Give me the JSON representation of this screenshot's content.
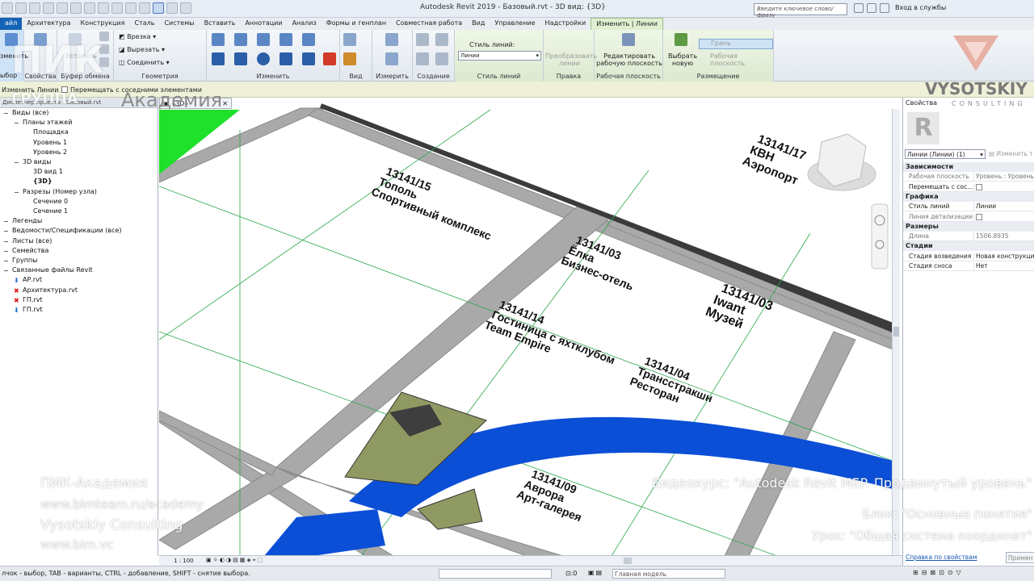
{
  "titlebar": {
    "title": "Autodesk Revit 2019 - Базовый.rvt - 3D вид: {3D}",
    "search_placeholder": "Введите ключевое слово/фразу",
    "login": "Вход в службы"
  },
  "tabs": [
    {
      "label": "айл",
      "kind": "file"
    },
    {
      "label": "Архитектура"
    },
    {
      "label": "Конструкция"
    },
    {
      "label": "Сталь"
    },
    {
      "label": "Системы"
    },
    {
      "label": "Вставить"
    },
    {
      "label": "Аннотации"
    },
    {
      "label": "Анализ"
    },
    {
      "label": "Формы и генплан"
    },
    {
      "label": "Совместная работа"
    },
    {
      "label": "Вид"
    },
    {
      "label": "Управление"
    },
    {
      "label": "Надстройки"
    },
    {
      "label": "Изменить | Линии",
      "kind": "active"
    }
  ],
  "ribbon": {
    "modify_label": "зменить",
    "insert_label": "Вставить",
    "select_label": "ыбор",
    "properties_label": "Свойства",
    "clipboard_label": "Буфер обмена",
    "geometry_label": "Геометрия",
    "cut_label": "Врезка",
    "cut2_label": "Вырезать",
    "join_label": "Соединить",
    "modify_group_label": "Изменить",
    "view_group_label": "Вид",
    "measure_label": "Измерить",
    "create_label": "Создание",
    "line_style_caption": "Стиль линий:",
    "line_style_value": "Линии",
    "line_style_group": "Стиль линий",
    "convert_lines": "Преобразовать линии",
    "edit_label": "Правка",
    "edit_workplane": "Редактировать рабочую плоскость",
    "workplane_group": "Рабочая плоскость",
    "pick_new": "Выбрать новую",
    "face": "Грань",
    "work_plane": "Рабочая плоскость",
    "placement_group": "Размещение"
  },
  "optbar": {
    "text1": "Изменить Линии",
    "text2": "Перемещать с соседними элементами"
  },
  "browser": {
    "header": "Диспетчер проекта - Базовый.rvt",
    "items": [
      {
        "label": "Виды (все)",
        "level": 0
      },
      {
        "label": "Планы этажей",
        "level": 1
      },
      {
        "label": "Площадка",
        "level": 2
      },
      {
        "label": "Уровень 1",
        "level": 2
      },
      {
        "label": "Уровень 2",
        "level": 2
      },
      {
        "label": "3D виды",
        "level": 1
      },
      {
        "label": "3D вид 1",
        "level": 2
      },
      {
        "label": "{3D}",
        "level": 2,
        "bold": true
      },
      {
        "label": "Разрезы (Номер узла)",
        "level": 1
      },
      {
        "label": "Сечение 0",
        "level": 2
      },
      {
        "label": "Сечение 1",
        "level": 2
      },
      {
        "label": "Легенды",
        "level": 0
      },
      {
        "label": "Ведомости/Спецификации (все)",
        "level": 0
      },
      {
        "label": "Листы (все)",
        "level": 0
      },
      {
        "label": "Семейства",
        "level": 0
      },
      {
        "label": "Группы",
        "level": 0
      },
      {
        "label": "Связанные файлы Revit",
        "level": 0
      },
      {
        "label": "АР.rvt",
        "level": 1,
        "icon": "arrow"
      },
      {
        "label": "Архитектура.rvt",
        "level": 1,
        "icon": "cross"
      },
      {
        "label": "ГП.rvt",
        "level": 1,
        "icon": "cross"
      },
      {
        "label": "ГП.rvt",
        "level": 1,
        "icon": "arrow"
      }
    ]
  },
  "view_tab": {
    "label": "{3D}"
  },
  "view_scale": "1 : 100",
  "properties": {
    "header": "Свойства",
    "type_selector": "Линии (Линии) (1)",
    "edit_type": "Изменить т",
    "rows": [
      {
        "cat": "Зависимости"
      },
      {
        "name": "Рабочая плоскость",
        "value": "Уровень : Уровень 1",
        "grey": true
      },
      {
        "name": "Перемещать с сос...",
        "value": "",
        "checkbox": true
      },
      {
        "cat": "Графика"
      },
      {
        "name": "Стиль линий",
        "value": "Линии"
      },
      {
        "name": "Линия детализации",
        "value": "",
        "checkbox": true,
        "grey": true
      },
      {
        "cat": "Размеры"
      },
      {
        "name": "Длина",
        "value": "1506.8935",
        "grey": true
      },
      {
        "cat": "Стадии"
      },
      {
        "name": "Стадия возведения",
        "value": "Новая конструкция"
      },
      {
        "name": "Стадия сноса",
        "value": "Нет"
      }
    ],
    "help_link": "Справка по свойствам",
    "apply_button": "Примен"
  },
  "status": {
    "hint": "лчок - выбор, TAB - варианты, CTRL - добавление, SHIFT - снятие выбора.",
    "coord": ":0",
    "model": "Главная модель"
  },
  "labels": [
    {
      "code": "13141/15",
      "name": "Тополь",
      "sub": "Спортивный комплекс"
    },
    {
      "code": "13141/17",
      "name": "КВН",
      "sub": "Аэропорт"
    },
    {
      "code": "13141/03",
      "name": "Ёлка",
      "sub": "Бизнес-отель"
    },
    {
      "code": "13141/03",
      "name": "Iwant",
      "sub": "Музей"
    },
    {
      "code": "13141/14",
      "name": "Гостиница с яхтклубом",
      "sub": "Team Empire"
    },
    {
      "code": "13141/04",
      "name": "Трансстракшн",
      "sub": "Ресторан"
    },
    {
      "code": "13141/09",
      "name": "Аврора",
      "sub": "Арт-галерея"
    }
  ],
  "overlay": {
    "brand_top": "ПИК",
    "brand_group": "ГРУППА",
    "brand_academy": "Академия",
    "vysotskiy": "VYSOTSKIY",
    "consulting": "CONSULTING",
    "school": "ПИК-Академия",
    "url1": "www.bimteam.ru/academy",
    "company": "Vysotskiy Consulting",
    "url2": "www.bim.vc",
    "course": "Видеокурс: \"Autodesk Revit MEP. Продвинутый уровень\"",
    "block": "Блок: \"Основные понятия\"",
    "lesson": "Урок: \"Общая система координат\""
  }
}
